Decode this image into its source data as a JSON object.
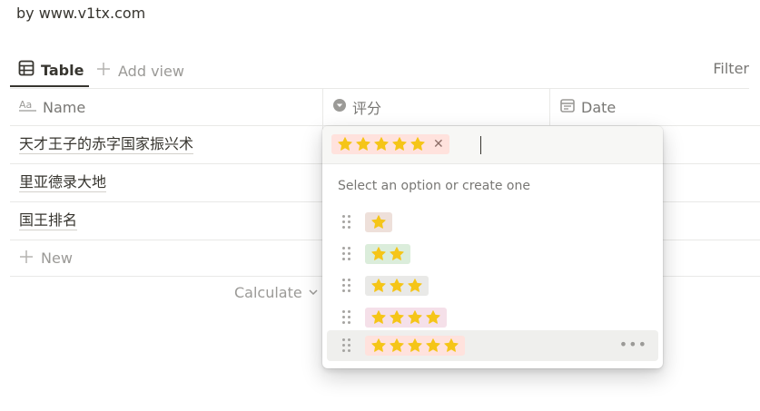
{
  "byline": "by www.v1tx.com",
  "views": {
    "active_tab": "Table",
    "add_view": "Add view",
    "filter": "Filter"
  },
  "table": {
    "columns": [
      {
        "label": "Name",
        "icon": "text-property-icon"
      },
      {
        "label": "评分",
        "icon": "select-property-icon"
      },
      {
        "label": "Date",
        "icon": "calendar-icon"
      }
    ],
    "rows": [
      {
        "name": "天才王子的赤字国家振兴术"
      },
      {
        "name": "里亚德录大地"
      },
      {
        "name": "国王排名"
      }
    ],
    "new_label": "New",
    "calculate_label": "Calculate"
  },
  "dropdown": {
    "selected": {
      "stars": 5,
      "color": "#ffe2dd"
    },
    "hint": "Select an option or create one",
    "options": [
      {
        "stars": 1,
        "color": "#eee0da"
      },
      {
        "stars": 2,
        "color": "#dbeddb"
      },
      {
        "stars": 3,
        "color": "#e9e9e7"
      },
      {
        "stars": 4,
        "color": "#f5e0e9"
      },
      {
        "stars": 5,
        "color": "#ffe2dd"
      }
    ],
    "more_icon": "more-horizontal-icon"
  },
  "colors": {
    "star": "#f5c518",
    "text": "#37352f",
    "muted": "#9b9a97"
  }
}
